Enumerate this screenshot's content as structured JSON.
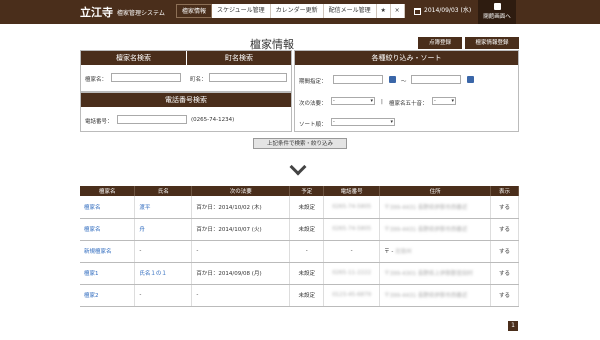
{
  "header": {
    "logo": "立江寺",
    "system_name": "檀家管理システム",
    "tabs": [
      {
        "label": "檀家情報",
        "active": true
      },
      {
        "label": "スケジュール管理",
        "active": false
      },
      {
        "label": "カレンダー更新",
        "active": false
      },
      {
        "label": "配信メール管理",
        "active": false
      },
      {
        "label": "★",
        "active": false
      },
      {
        "label": "×",
        "active": false
      }
    ],
    "date": "2014/09/03 (水)",
    "close_label": "閉館画面へ"
  },
  "page": {
    "title": "檀家情報",
    "buttons": {
      "register": "点簿登録",
      "danka_register": "檀家情報登録"
    }
  },
  "search": {
    "name_section": "檀家名検索",
    "town_section": "町名検索",
    "name_label": "檀家名：",
    "town_label": "町名：",
    "phone_section": "電話番号検索",
    "phone_label": "電話番号：",
    "phone_hint": "(0265-74-1234)",
    "filter_section": "各種絞り込み・ソート",
    "period_label": "期間指定：",
    "tilde": "～",
    "next_event_label": "次の法要：",
    "next_event_value": "-",
    "kana_label": "檀家名五十音：",
    "kana_value": "-",
    "sort_label": "ソート順：",
    "sort_value": "-",
    "divider": "|",
    "submit": "上記条件で検索・絞り込み"
  },
  "results": {
    "columns": [
      "檀家名",
      "氏名",
      "次の法要",
      "予定",
      "電話番号",
      "住所",
      "表示"
    ],
    "rows": [
      {
        "danka": "檀家名",
        "name": "渡平",
        "event": "百か日：2014/10/02 (木)",
        "plan": "未設定",
        "phone": "0265-74-5805",
        "addr_zip": "〒399-4431",
        "addr": "長野県伊那市西春近",
        "show": "する"
      },
      {
        "danka": "檀家名",
        "name": "舟",
        "event": "百か日：2014/10/07 (火)",
        "plan": "未設定",
        "phone": "0265-74-5805",
        "addr_zip": "〒399-4431",
        "addr": "長野県伊那市西春近",
        "show": "する"
      },
      {
        "danka": "新規檀家名",
        "name": "-",
        "event": "-",
        "plan": "-",
        "phone": "-",
        "addr_zip": "〒 -",
        "addr": "北信州",
        "show": "する"
      },
      {
        "danka": "檀家1",
        "name": "氏名１の１",
        "event": "百か日：2014/09/08 (月)",
        "plan": "未設定",
        "phone": "0265-11-2222",
        "addr_zip": "〒399-4301",
        "addr": "長野県上伊那郡宮田村",
        "show": "する"
      },
      {
        "danka": "檀家2",
        "name": "-",
        "event": "-",
        "plan": "未設定",
        "phone": "0123-45-6879",
        "addr_zip": "〒399-4431",
        "addr": "長野県伊那市西春近",
        "show": "する"
      }
    ],
    "page": "1"
  }
}
